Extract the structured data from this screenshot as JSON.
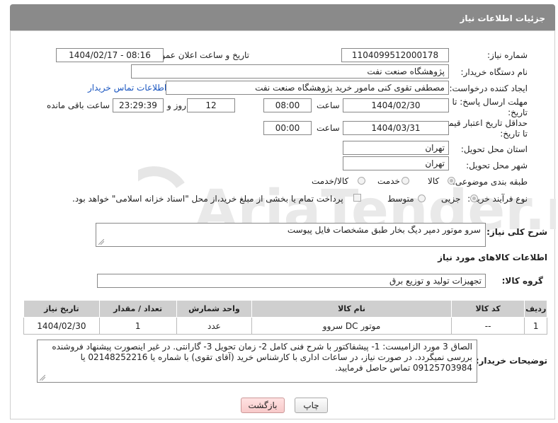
{
  "header": {
    "title": "جزئیات اطلاعات نیاز"
  },
  "watermark": {
    "text": "AriaTender.net"
  },
  "fields": {
    "need_number_label": "شماره نیاز:",
    "need_number": "1104099512000178",
    "announce_label": "تاریخ و ساعت اعلان عمومی:",
    "announce_value": "1404/02/17 - 08:16",
    "buyer_org_label": "نام دستگاه خریدار:",
    "buyer_org": "پژوهشگاه صنعت نفت",
    "creator_label": "ایجاد کننده درخواست:",
    "creator": "مصطفی تقوی کنی مامور خرید پژوهشگاه صنعت نفت",
    "contact_link": "اطلاعات تماس خریدار",
    "deadline_label_1": "مهلت ارسال پاسخ: تا",
    "deadline_label_2": "تاریخ:",
    "deadline_date": "1404/02/30",
    "time_label": "ساعت",
    "deadline_time": "08:00",
    "days_value": "12",
    "days_label": "روز و",
    "remaining_time": "23:29:39",
    "remaining_label": "ساعت باقی مانده",
    "validity_label_1": "حداقل تاریخ اعتبار قیمت:",
    "validity_label_2": "تا تاریخ:",
    "validity_date": "1404/03/31",
    "validity_time": "00:00",
    "province_label": "استان محل تحویل:",
    "province": "تهران",
    "city_label": "شهر محل تحویل:",
    "city": "تهران",
    "category_label": "طبقه بندی موضوعی:",
    "category_options": [
      "کالا",
      "خدمت",
      "کالا/خدمت"
    ],
    "process_label": "نوع فرآیند خرید :",
    "process_options": [
      "جزیی",
      "متوسط"
    ],
    "payment_note": "پرداخت تمام یا بخشی از مبلغ خرید،از محل \"اسناد خزانه اسلامی\" خواهد بود.",
    "description_label": "شرح کلی نیاز:",
    "description": "سرو موتور دمپر دیگ بخار طبق مشخصات فایل پیوست"
  },
  "goods": {
    "section_title": "اطلاعات کالاهای مورد نیاز",
    "group_label": "گروه کالا:",
    "group_value": "تجهیزات تولید و توزیع برق",
    "columns": [
      "ردیف",
      "کد کالا",
      "نام کالا",
      "واحد شمارش",
      "تعداد / مقدار",
      "تاریخ نیاز"
    ],
    "rows": [
      [
        "1",
        "--",
        "موتور DC سروو",
        "عدد",
        "1",
        "1404/02/30"
      ]
    ]
  },
  "buyer_notes": {
    "label": "توضیحات خریدار:",
    "text": "الصاق 3 مورد الزامیست: 1- پیشفاکتور با شرح فنی کامل 2- زمان تحویل 3- گارانتی. در غیر اینصورت پیشنهاد فروشنده بررسی نمیگردد. در صورت نیاز، در ساعات اداری با کارشناس خرید (آقای تقوی) با شماره یا 02148252216 یا 09125703984 تماس حاصل فرمایید."
  },
  "buttons": {
    "print": "چاپ",
    "back": "بازگشت"
  },
  "colors": {
    "header_bg": "#8a8a8a",
    "link": "#1a56c0",
    "back_button": "#f7c9c9"
  }
}
